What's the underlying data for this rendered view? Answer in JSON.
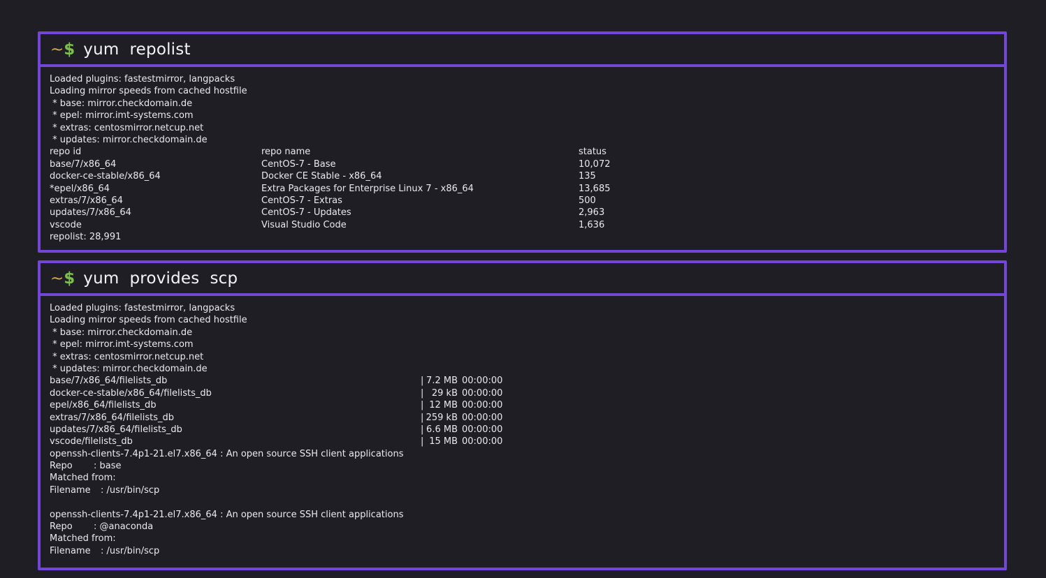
{
  "colors": {
    "background": "#201e25",
    "panel_border": "#7446d8",
    "prompt_tilde": "#d9a646",
    "prompt_dollar": "#7bc04a",
    "text": "#ebe9f0"
  },
  "prompt": {
    "tilde": "~",
    "dollar": "$"
  },
  "panel1": {
    "command": "yum  repolist",
    "lines": [
      "Loaded plugins: fastestmirror, langpacks",
      "Loading mirror speeds from cached hostfile",
      " * base: mirror.checkdomain.de",
      " * epel: mirror.imt-systems.com",
      " * extras: centosmirror.netcup.net",
      " * updates: mirror.checkdomain.de"
    ],
    "table": {
      "headers": {
        "id": "repo id",
        "name": "repo name",
        "status": "status"
      },
      "rows": [
        {
          "id": "base/7/x86_64",
          "name": "CentOS-7 - Base",
          "status": "10,072"
        },
        {
          "id": "docker-ce-stable/x86_64",
          "name": "Docker CE Stable - x86_64",
          "status": "135"
        },
        {
          "id": "*epel/x86_64",
          "name": "Extra Packages for Enterprise Linux 7 - x86_64",
          "status": "13,685"
        },
        {
          "id": "extras/7/x86_64",
          "name": "CentOS-7 - Extras",
          "status": "500"
        },
        {
          "id": "updates/7/x86_64",
          "name": "CentOS-7 - Updates",
          "status": "2,963"
        },
        {
          "id": "vscode",
          "name": "Visual Studio Code",
          "status": "1,636"
        }
      ]
    },
    "footer": "repolist: 28,991"
  },
  "panel2": {
    "command": "yum  provides  scp",
    "lines": [
      "Loaded plugins: fastestmirror, langpacks",
      "Loading mirror speeds from cached hostfile",
      " * base: mirror.checkdomain.de",
      " * epel: mirror.imt-systems.com",
      " * extras: centosmirror.netcup.net",
      " * updates: mirror.checkdomain.de"
    ],
    "downloads": [
      {
        "name": "base/7/x86_64/filelists_db",
        "bar": "|",
        "size": "7.2 MB",
        "time": "00:00:00"
      },
      {
        "name": "docker-ce-stable/x86_64/filelists_db",
        "bar": "|",
        "size": "29 kB",
        "time": "00:00:00"
      },
      {
        "name": "epel/x86_64/filelists_db",
        "bar": "|",
        "size": "12 MB",
        "time": "00:00:00"
      },
      {
        "name": "extras/7/x86_64/filelists_db",
        "bar": "|",
        "size": "259 kB",
        "time": "00:00:00"
      },
      {
        "name": "updates/7/x86_64/filelists_db",
        "bar": "|",
        "size": "6.6 MB",
        "time": "00:00:00"
      },
      {
        "name": "vscode/filelists_db",
        "bar": "|",
        "size": "15 MB",
        "time": "00:00:00"
      }
    ],
    "results": [
      {
        "package": "openssh-clients-7.4p1-21.el7.x86_64 : An open source SSH client applications",
        "repo_label": "Repo",
        "repo_value": ": base",
        "matched": "Matched from:",
        "filename_label": "Filename",
        "filename_value": ": /usr/bin/scp"
      },
      {
        "package": "openssh-clients-7.4p1-21.el7.x86_64 : An open source SSH client applications",
        "repo_label": "Repo",
        "repo_value": ": @anaconda",
        "matched": "Matched from:",
        "filename_label": "Filename",
        "filename_value": ": /usr/bin/scp"
      }
    ]
  }
}
